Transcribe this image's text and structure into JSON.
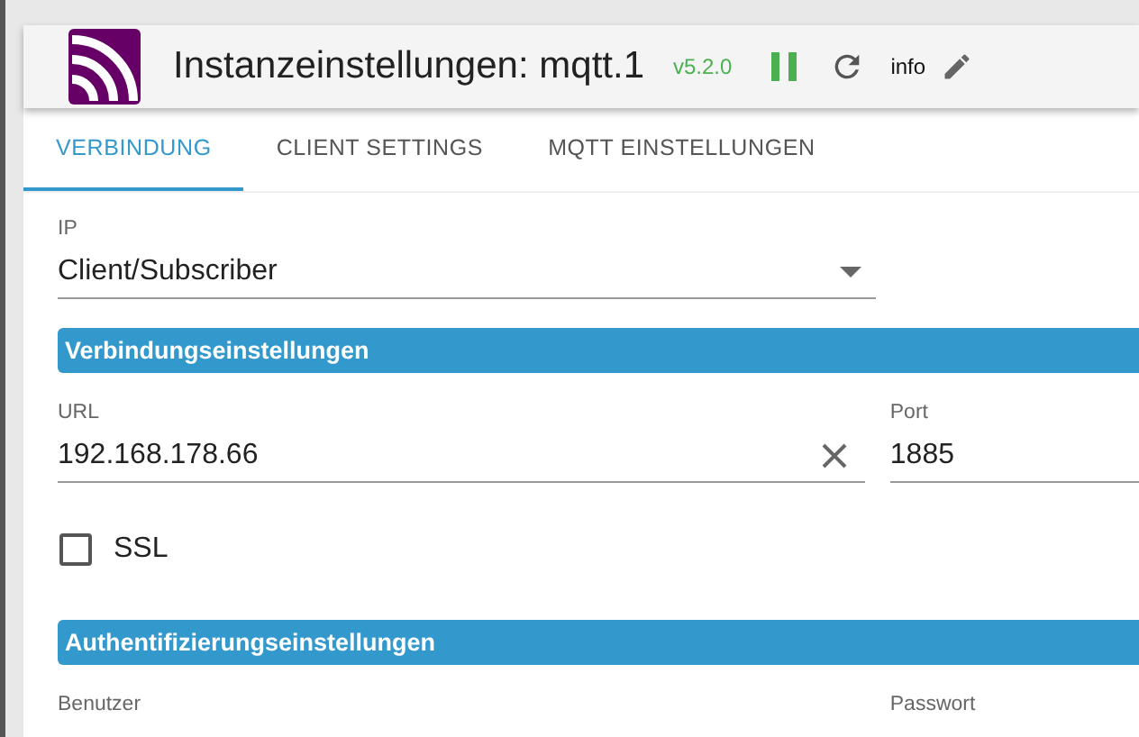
{
  "header": {
    "title": "Instanzeinstellungen: mqtt.1",
    "version": "v5.2.0",
    "info_label": "info"
  },
  "tabs": [
    {
      "label": "VERBINDUNG",
      "selected": true
    },
    {
      "label": "CLIENT SETTINGS",
      "selected": false
    },
    {
      "label": "MQTT EINSTELLUNGEN",
      "selected": false
    }
  ],
  "ip_select": {
    "label": "IP",
    "value": "Client/Subscriber"
  },
  "sections": [
    {
      "title": "Verbindungseinstellungen",
      "fields": [
        {
          "label": "URL",
          "value": "192.168.178.66",
          "clearable": true
        },
        {
          "label": "Port",
          "value": "1885",
          "clearable": false
        }
      ],
      "checkbox": {
        "label": "SSL",
        "checked": false
      }
    },
    {
      "title": "Authentifizierungseinstellungen",
      "fields": [
        {
          "label": "Benutzer"
        },
        {
          "label": "Passwort"
        }
      ]
    }
  ]
}
